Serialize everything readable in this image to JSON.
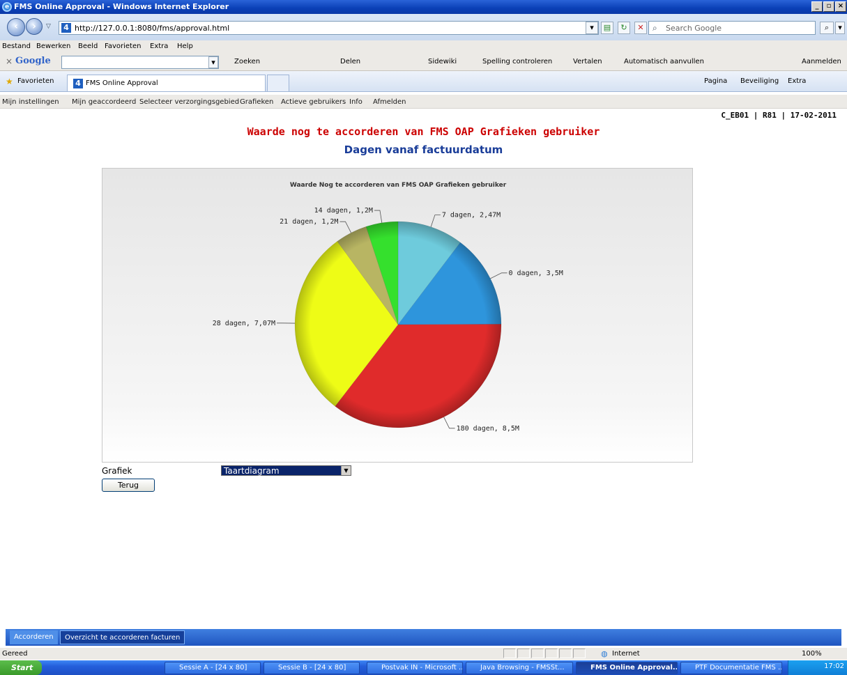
{
  "window": {
    "title": "FMS Online Approval - Windows Internet Explorer",
    "controls": [
      "_",
      "▫",
      "×"
    ]
  },
  "address": {
    "url": "http://127.0.0.1:8080/fms/approval.html",
    "search_placeholder": "Search Google"
  },
  "menu": [
    "Bestand",
    "Bewerken",
    "Beeld",
    "Favorieten",
    "Extra",
    "Help"
  ],
  "google_toolbar": {
    "brand": "Google",
    "items": [
      "Zoeken",
      "Delen",
      "Sidewiki",
      "Spelling controleren",
      "Vertalen",
      "Automatisch aanvullen",
      "Aanmelden"
    ]
  },
  "favorites": {
    "label": "Favorieten",
    "tab_title": "FMS Online Approval",
    "command_items": [
      "Pagina",
      "Beveiliging",
      "Extra"
    ]
  },
  "app_nav": [
    "Mijn instellingen",
    "Mijn geaccordeerd",
    "Selecteer verzorgingsgebied",
    "Grafieken",
    "Actieve gebruikers",
    "Info",
    "Afmelden"
  ],
  "user_info": "C_EB01 | R81 | 17-02-2011",
  "page": {
    "title": "Waarde nog te accorderen van FMS OAP Grafieken gebruiker",
    "subtitle": "Dagen vanaf factuurdatum"
  },
  "chart_data": {
    "type": "pie",
    "title": "Waarde Nog te accorderen van FMS OAP Grafieken gebruiker",
    "slices": [
      {
        "label": "0 dagen, 3,5M",
        "value": 3.5,
        "color": "#2e95dc"
      },
      {
        "label": "180 dagen, 8,5M",
        "value": 8.5,
        "color": "#e02b2b"
      },
      {
        "label": "28 dagen, 7,07M",
        "value": 7.07,
        "color": "#eefc16"
      },
      {
        "label": "21 dagen, 1,2M",
        "value": 1.2,
        "color": "#b8b563"
      },
      {
        "label": "14 dagen, 1,2M",
        "value": 1.2,
        "color": "#35e02d"
      },
      {
        "label": "7 dagen, 2,47M",
        "value": 2.47,
        "color": "#6ecbdc"
      }
    ]
  },
  "form": {
    "grafiek_label": "Grafiek",
    "grafiek_value": "Taartdiagram",
    "back_button": "Terug"
  },
  "bottom_tabs": [
    "Accorderen",
    "Overzicht te accorderen facturen"
  ],
  "status": {
    "text": "Gereed",
    "zone": "Internet",
    "zoom": "100%"
  },
  "taskbar": {
    "start": "Start",
    "tasks": [
      "Sessie A - [24 x 80]",
      "Sessie B - [24 x 80]",
      "Postvak IN - Microsoft ...",
      "Java Browsing - FMSSt...",
      "FMS Online Approval...",
      "PTF Documentatie FMS ..."
    ],
    "clock": "17:02"
  }
}
